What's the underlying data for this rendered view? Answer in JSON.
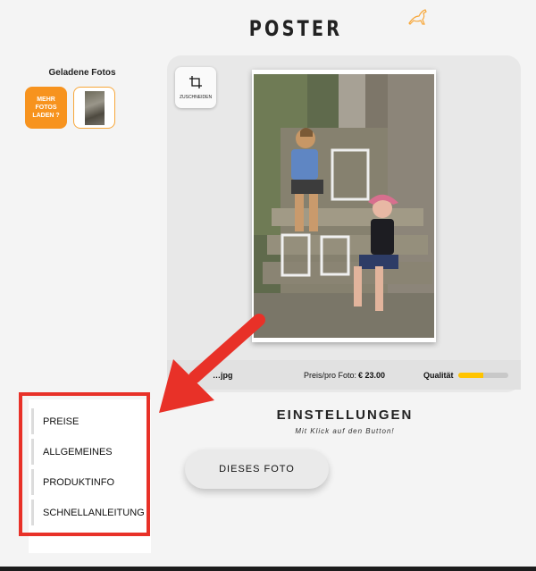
{
  "header": {
    "title": "POSTER",
    "logo_icon": "kangaroo-icon"
  },
  "photos": {
    "label": "Geladene Fotos",
    "load_more_label": "MEHR FOTOS LADEN ?"
  },
  "editor": {
    "crop_label": "ZUSCHNEIDEN",
    "filename": "…jpg",
    "price_label": "Preis/pro Foto:",
    "price_value": "€ 23.00",
    "quality_label": "Qualität",
    "quality_level": 0.5
  },
  "settings": {
    "title": "EINSTELLUNGEN",
    "subtitle": "Mit Klick auf den Button!",
    "this_photo_button": "DIESES FOTO"
  },
  "menu": {
    "items": [
      {
        "label": "PREISE"
      },
      {
        "label": "ALLGEMEINES"
      },
      {
        "label": "PRODUKTINFO"
      },
      {
        "label": "SCHNELLANLEITUNG"
      }
    ]
  },
  "colors": {
    "accent": "#f7931e",
    "highlight": "#e83128",
    "quality": "#ffc400"
  }
}
